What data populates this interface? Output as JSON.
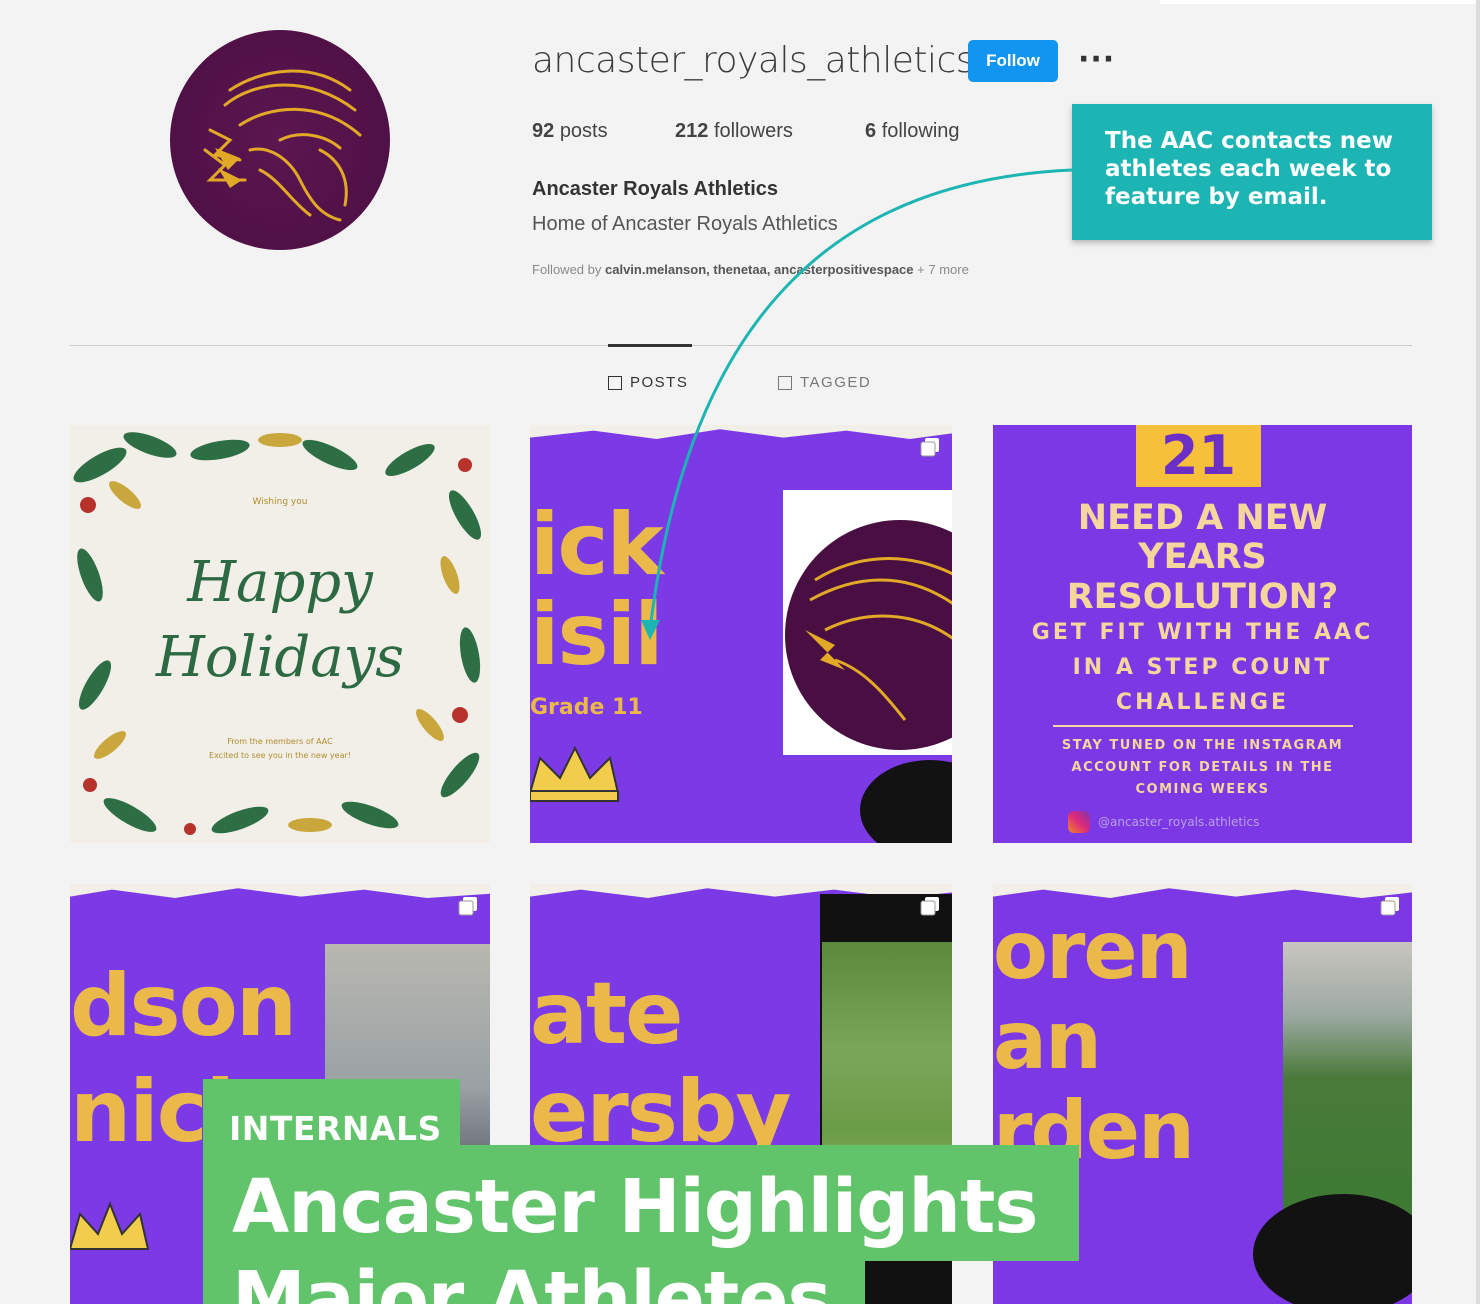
{
  "profile": {
    "username": "ancaster_royals_athletics",
    "follow_label": "Follow",
    "more_label": "···",
    "posts_count": "92",
    "posts_label": "posts",
    "followers_count": "212",
    "followers_label": "followers",
    "following_count": "6",
    "following_label": "following",
    "full_name": "Ancaster Royals Athletics",
    "bio": "Home of Ancaster Royals Athletics",
    "followed_by_prefix": "Followed by",
    "followed_by_names": "calvin.melanson, thenetaa, ancasterpositivespace",
    "followed_by_suffix": "+ 7 more"
  },
  "tabs": [
    {
      "label": "POSTS",
      "icon": "grid-icon",
      "active": true
    },
    {
      "label": "TAGGED",
      "icon": "tag-icon",
      "active": false
    }
  ],
  "posts": {
    "p1": {
      "small_top": "Wishing you",
      "script_1": "Happy",
      "script_2": "Holidays",
      "footer_1": "From the members of AAC",
      "footer_2": "Excited to see you in the new year!"
    },
    "p2": {
      "line1": "ick",
      "line2": "isil",
      "grade": "Grade 11"
    },
    "p3": {
      "number": "21",
      "line1": "NEED A NEW",
      "line2": "YEARS",
      "line3": "RESOLUTION?",
      "line4": "GET FIT WITH THE AAC",
      "line5": "IN A STEP COUNT",
      "line6": "CHALLENGE",
      "line7": "STAY TUNED ON THE INSTAGRAM",
      "line8": "ACCOUNT FOR DETAILS IN THE",
      "line9": "COMING WEEKS",
      "handle": "@ancaster_royals.athletics"
    },
    "p4": {
      "line1": "dson",
      "line2": "nich"
    },
    "p5": {
      "line1": "ate",
      "line2": "ersby"
    },
    "p6": {
      "line1": "oren",
      "line2": "an",
      "line3": "rden"
    }
  },
  "callout": {
    "text": "The AAC contacts new athletes each week to feature by email."
  },
  "overlay": {
    "label": "INTERNALS",
    "title_1": "Ancaster Highlights",
    "title_2": "Major Athletes"
  },
  "colors": {
    "follow_blue": "#1195f0",
    "callout_teal": "#1cb5b3",
    "overlay_green": "#62c46a",
    "post_purple": "#7c3ae6",
    "gold": "#eab94a"
  }
}
